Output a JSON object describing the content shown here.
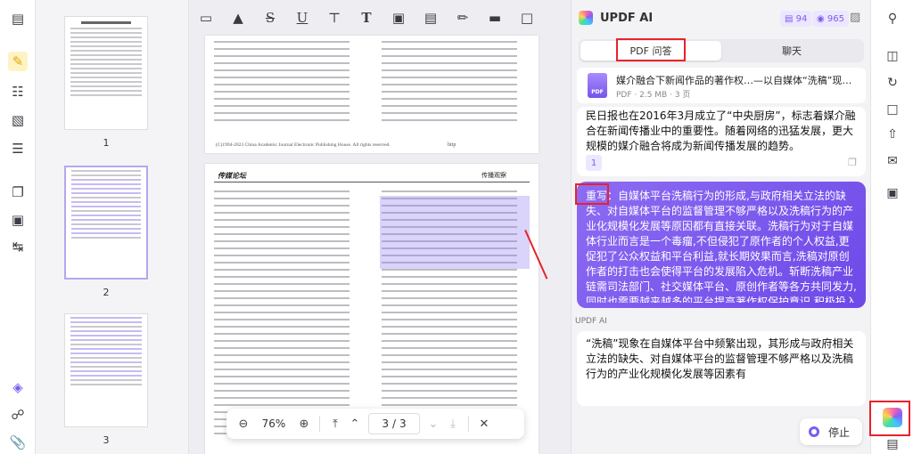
{
  "thumbnails": {
    "pages": [
      "1",
      "2",
      "3"
    ]
  },
  "document": {
    "page1_footer": "(C)1994-2023 China Academic Journal Electronic Publishing House. All rights reserved.",
    "page1_footer_tag": "http",
    "page2_left_header": "传媒论坛",
    "page2_right_header": "传播观察",
    "zoom": "76%",
    "page_current": "3",
    "page_total": "3",
    "page_sep": "/"
  },
  "ai": {
    "title": "UPDF AI",
    "credits_a": "94",
    "credits_b": "965",
    "tab_pdf": "PDF 问答",
    "tab_chat": "聊天",
    "file_name": "媒介融合下新闻作品的著作权…—以自媒体“洗稿”现象为例…",
    "file_meta": "PDF · 2.5 MB · 3 页",
    "msg1_text": "民日报也在2016年3月成立了“中央厨房”，标志着媒介融合在新闻传播业中的重要性。随着网络的迅猛发展，更大规模的媒介融合将成为新闻传播发展的趋势。",
    "msg1_badge": "1",
    "user_prefix": "重写：",
    "user_text": "自媒体平台洗稿行为的形成,与政府相关立法的缺失、对自媒体平台的监督管理不够严格以及洗稿行为的产业化规模化发展等原因都有直接关联。洗稿行为对于自媒体行业而言是一个毒瘤,不但侵犯了原作者的个人权益,更促犯了公众权益和平台利益,就长期效果而言,洗稿对原创作者的打击也会使得平台的发展陷入危机。斩断洗稿产业链需司法部门、社交媒体平台、原创作者等各方共同发力,同时也需要越来越多的平台提高著作权保护意识,积极投入监督队伍,共同根除“洗稿”产业的滋生土壤。",
    "ai_label": "UPDF AI",
    "answer_text": "“洗稿”现象在自媒体平台中频繁出现，其形成与政府相关立法的缺失、对自媒体平台的监督管理不够严格以及洗稿行为的产业化规模化发展等因素有",
    "stop_label": "停止"
  },
  "colors": {
    "accent": "#7b5cf0",
    "highlight_box": "#e8222a"
  }
}
